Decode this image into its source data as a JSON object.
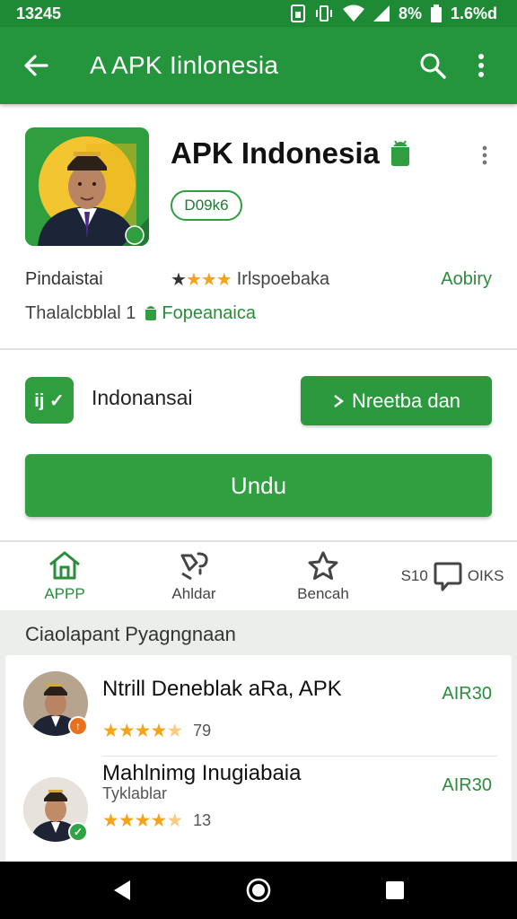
{
  "status_bar": {
    "time": "13245",
    "battery_text": "8%",
    "battery_text2": "1.6%d"
  },
  "toolbar": {
    "title": "A APK Iinlonesia"
  },
  "app": {
    "name": "APK Indonesia",
    "version": "D09k6",
    "publisher": "Pindaistai",
    "rating_label": "Irlspoebaka",
    "category": "Aobiry",
    "sub_label": "Thalalcbblal 1",
    "platform_tag": "Fopeanaica"
  },
  "actions": {
    "language": "Indonansai",
    "badge_text": "ij ✓",
    "secondary_button": "Nreetba dan",
    "download_button": "Undu"
  },
  "tabs": [
    {
      "label": "APPP",
      "icon": "home-icon"
    },
    {
      "label": "Ahldar",
      "icon": "category-icon"
    },
    {
      "label": "Bencah",
      "icon": "star-icon"
    },
    {
      "label_left": "S10",
      "label_right": "OIKS",
      "icon": "chat-icon"
    }
  ],
  "related": {
    "section_title": "Ciaolapant Pyagngnaan",
    "items": [
      {
        "name": "Ntrill Deneblak aRa, APK",
        "reviews": "79",
        "price": "AIR30",
        "stars": 4.5,
        "badge_color": "#e8711f"
      },
      {
        "name": "Mahlnimg Inugiabaia",
        "subtitle": "Tyklablar",
        "reviews": "13",
        "price": "AIR30",
        "stars": 4.5,
        "badge_color": "#2fa444"
      }
    ]
  },
  "colors": {
    "primary": "#24953c",
    "accent": "#2f9f3f",
    "star": "#f3a41a"
  }
}
